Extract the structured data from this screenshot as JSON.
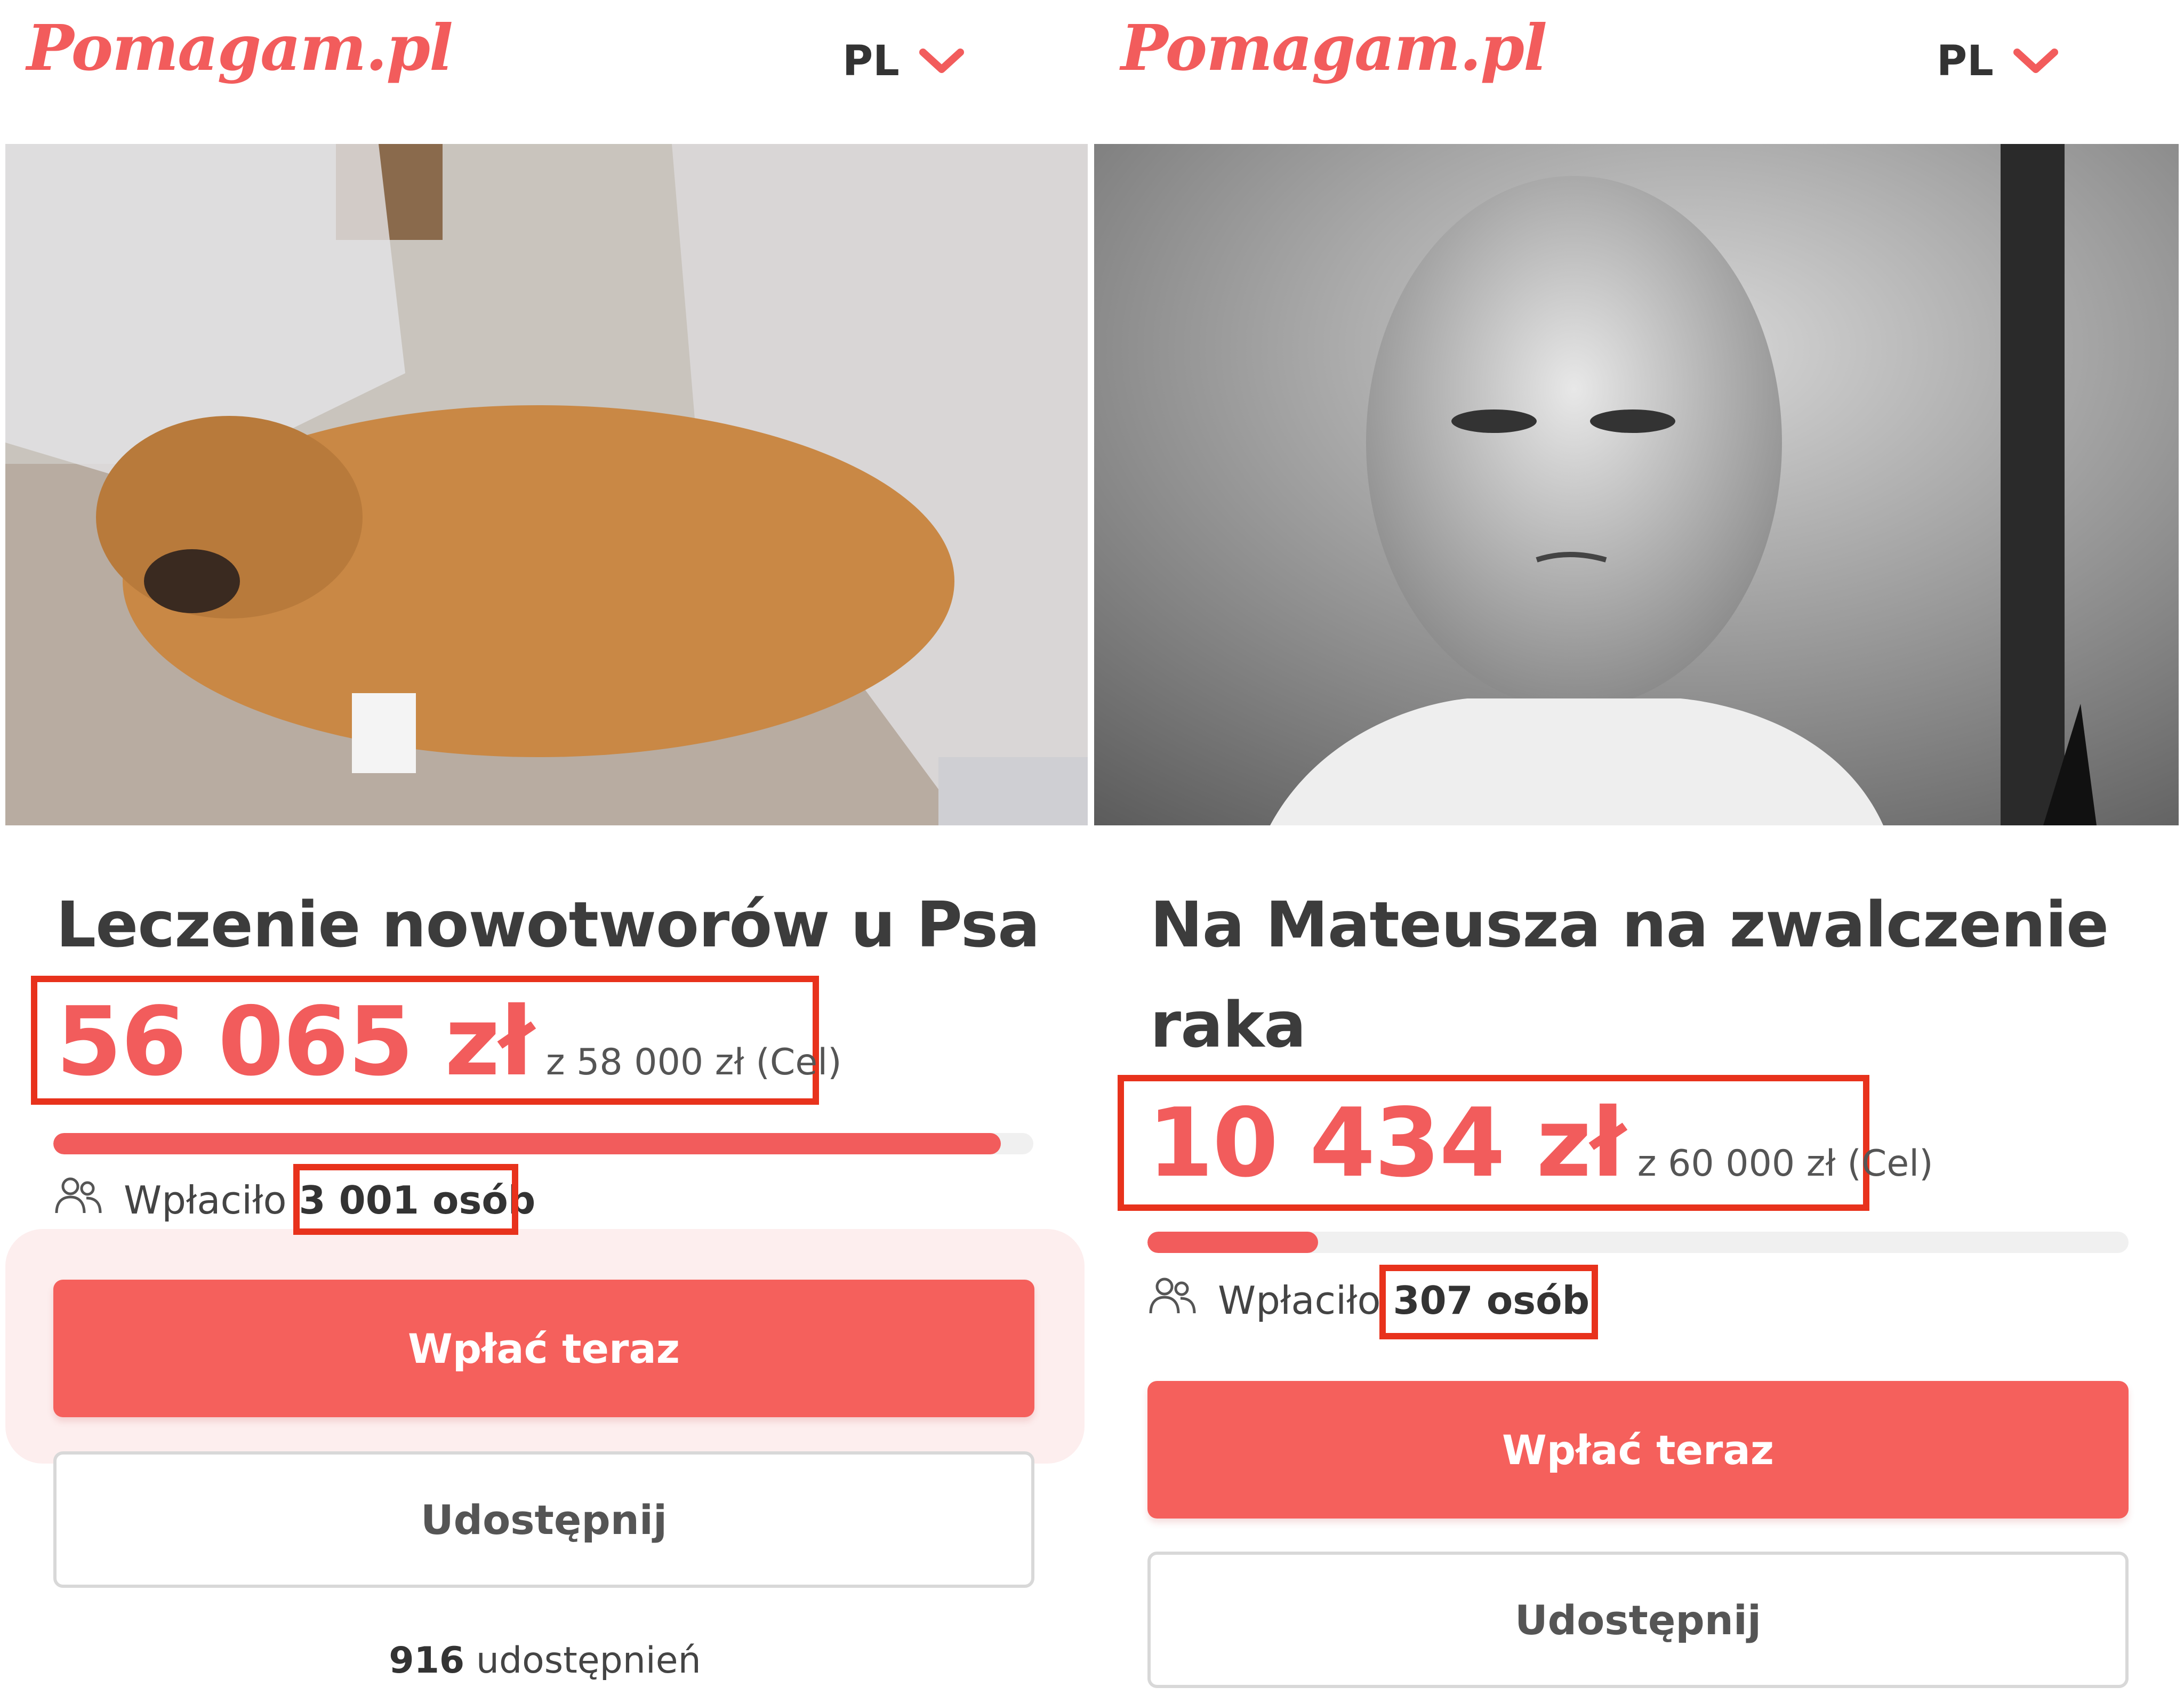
{
  "colors": {
    "brand": "#f25c5c",
    "annotation": "#e8321c",
    "text": "#3c3c3c"
  },
  "panels": [
    {
      "logo": "Pomagam.pl",
      "lang": "PL",
      "title": "Leczenie nowotworów u Psa",
      "raised": "56 065 zł",
      "goal": "z 58 000 zł (Cel)",
      "progress_fraction": 0.967,
      "donors_prefix": "Wpłaciło",
      "donors_count": "3 001 osób",
      "donate_label": "Wpłać teraz",
      "share_label": "Udostępnij",
      "shares_count": "916",
      "shares_suffix": "udostępnień"
    },
    {
      "logo": "Pomagam.pl",
      "lang": "PL",
      "title": "Na Mateusza na zwalczenie raka",
      "raised": "10 434 zł",
      "goal": "z 60 000 zł (Cel)",
      "progress_fraction": 0.174,
      "donors_prefix": "Wpłaciło",
      "donors_count": "307 osób",
      "donate_label": "Wpłać teraz",
      "share_label": "Udostępnij"
    }
  ]
}
